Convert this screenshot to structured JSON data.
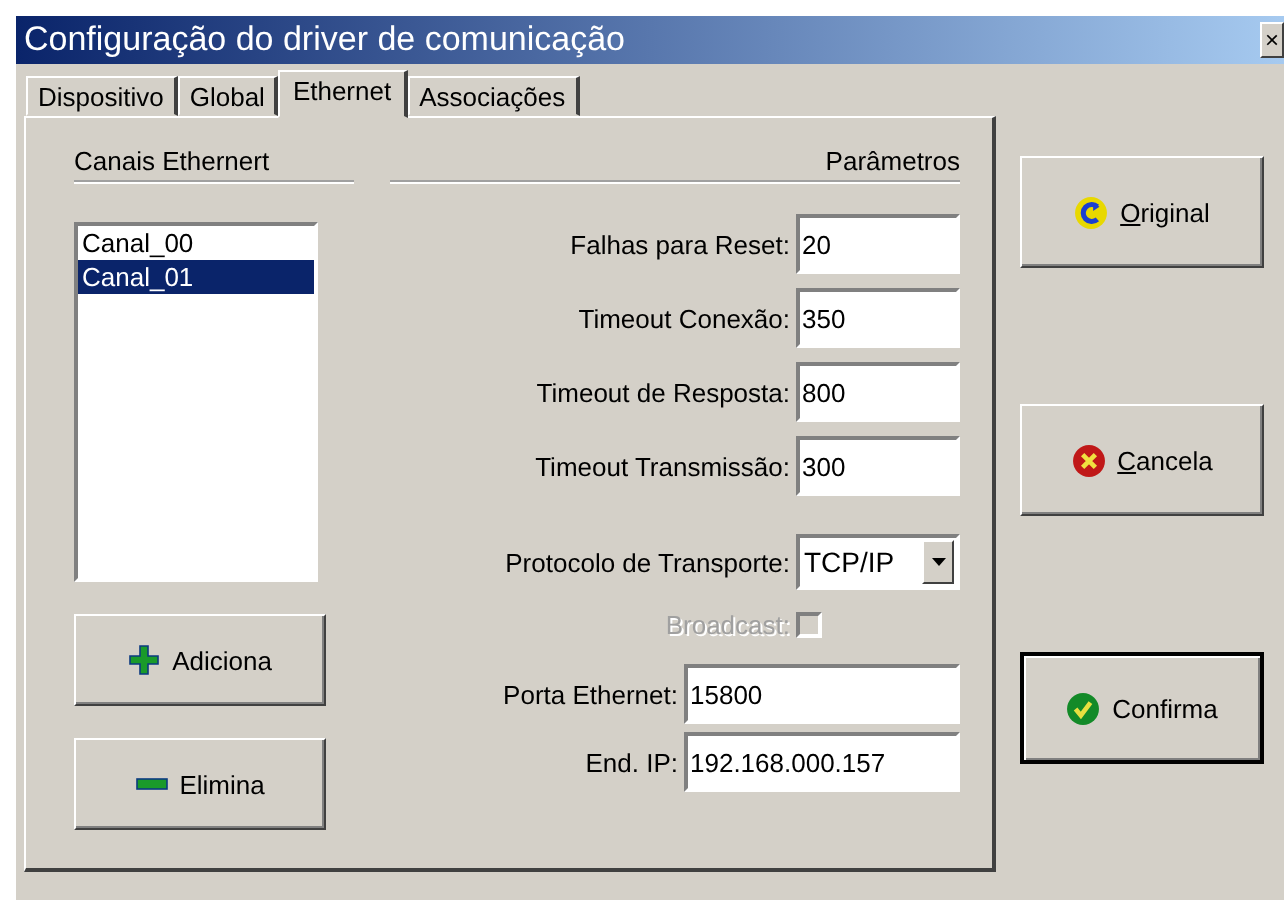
{
  "window": {
    "title": "Configuração do driver de comunicação",
    "close": "×"
  },
  "tabs": [
    {
      "label": "Dispositivo",
      "selected": false
    },
    {
      "label": "Global",
      "selected": false
    },
    {
      "label": "Ethernet",
      "selected": true
    },
    {
      "label": "Associações",
      "selected": false
    }
  ],
  "channels": {
    "heading": "Canais Ethernert",
    "items": [
      {
        "label": "Canal_00",
        "selected": false
      },
      {
        "label": "Canal_01",
        "selected": true
      }
    ],
    "buttons": [
      {
        "kind": "add",
        "label": "Adiciona"
      },
      {
        "kind": "remove",
        "label": "Elimina"
      }
    ]
  },
  "parameters": {
    "heading": "Parâmetros",
    "fields": [
      {
        "label": "Falhas para Reset:",
        "value": "20"
      },
      {
        "label": "Timeout Conexão:",
        "value": "350"
      },
      {
        "label": "Timeout de Resposta:",
        "value": "800"
      },
      {
        "label": "Timeout Transmissão:",
        "value": "300"
      }
    ],
    "protocol": {
      "label": "Protocolo de Transporte:",
      "value": "TCP/IP"
    },
    "broadcast": {
      "label": "Broadcast:",
      "checked": false,
      "disabled": true
    },
    "address_fields": [
      {
        "label": "Porta Ethernet:",
        "value": "15800"
      },
      {
        "label": "End. IP:",
        "value": "192.168.000.157"
      }
    ]
  },
  "actions": [
    {
      "kind": "restore",
      "label": "Original",
      "mnemonic": true,
      "default": false
    },
    {
      "kind": "cancel",
      "label": "Cancela",
      "mnemonic": true,
      "default": false
    },
    {
      "kind": "confirm",
      "label": "Confirma",
      "mnemonic": false,
      "default": true
    }
  ]
}
